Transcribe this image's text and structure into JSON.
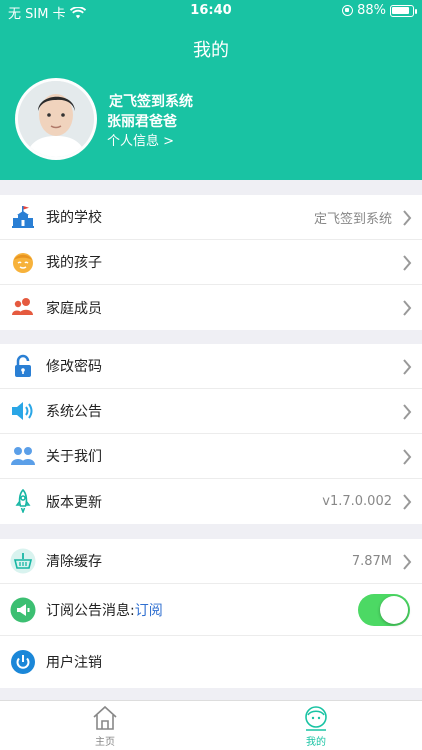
{
  "status_bar": {
    "carrier": "无 SIM 卡",
    "time": "16:40",
    "battery": "88%",
    "battery_level": 0.88
  },
  "header": {
    "title": "我的"
  },
  "profile": {
    "school": "定飞签到系统",
    "name": "张丽君爸爸",
    "info_link": "个人信息 >"
  },
  "menu": {
    "group1": [
      {
        "label": "我的学校",
        "value": "定飞签到系统",
        "icon": "school-icon"
      },
      {
        "label": "我的孩子",
        "value": "",
        "icon": "child-icon"
      },
      {
        "label": "家庭成员",
        "value": "",
        "icon": "family-icon"
      }
    ],
    "group2": [
      {
        "label": "修改密码",
        "value": "",
        "icon": "lock-icon"
      },
      {
        "label": "系统公告",
        "value": "",
        "icon": "speaker-icon"
      },
      {
        "label": "关于我们",
        "value": "",
        "icon": "people-icon"
      },
      {
        "label": "版本更新",
        "value": "v1.7.0.002",
        "icon": "rocket-icon"
      }
    ],
    "group3": {
      "clear_cache": {
        "label": "清除缓存",
        "value": "7.87M",
        "icon": "basket-icon"
      },
      "subscribe": {
        "label": "订阅公告消息:",
        "link": "订阅",
        "enabled": true,
        "icon": "megaphone-icon"
      },
      "logout": {
        "label": "用户注销",
        "icon": "power-icon"
      }
    }
  },
  "tabbar": {
    "home": "主页",
    "mine": "我的",
    "active_color": "#19c3a3"
  },
  "colors": {
    "header_bg": "#19c3a3",
    "switch_on": "#4cd964"
  }
}
